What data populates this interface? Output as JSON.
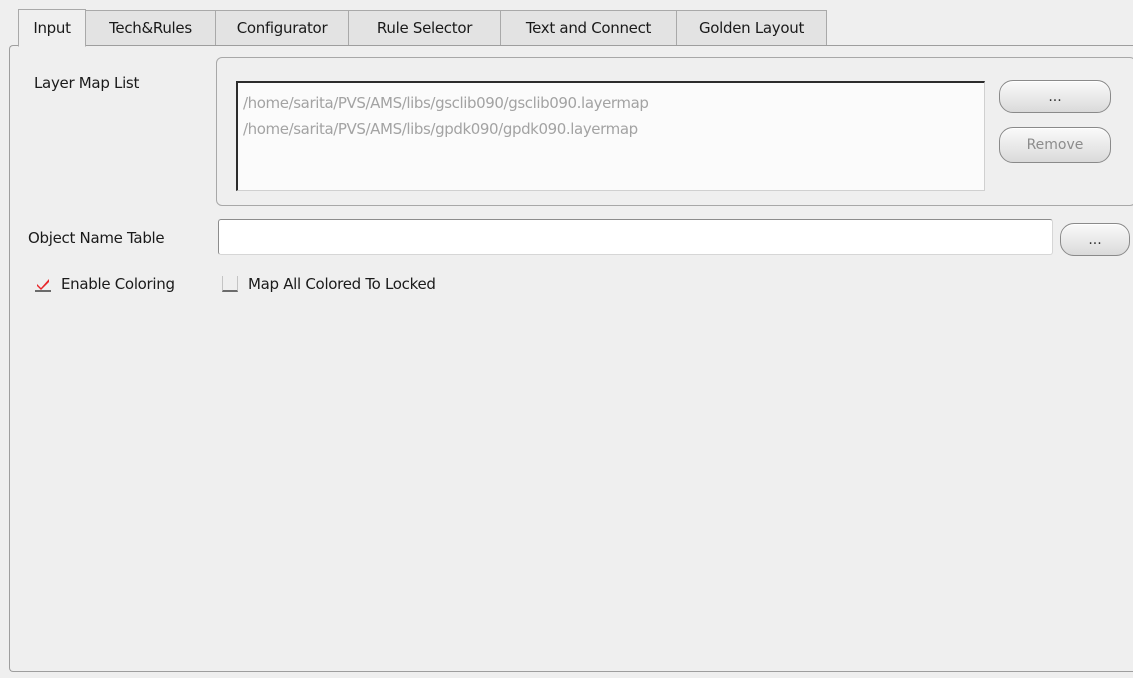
{
  "tabs": [
    {
      "label": "Input",
      "active": true
    },
    {
      "label": "Tech&Rules",
      "active": false
    },
    {
      "label": "Configurator",
      "active": false
    },
    {
      "label": "Rule Selector",
      "active": false
    },
    {
      "label": "Text and Connect",
      "active": false
    },
    {
      "label": "Golden Layout",
      "active": false
    }
  ],
  "layer_map": {
    "label": "Layer Map List",
    "items": [
      "/home/sarita/PVS/AMS/libs/gsclib090/gsclib090.layermap",
      "/home/sarita/PVS/AMS/libs/gpdk090/gpdk090.layermap"
    ],
    "browse_label": "...",
    "remove_label": "Remove"
  },
  "object_name_table": {
    "label": "Object Name Table",
    "value": "",
    "browse_label": "..."
  },
  "options": {
    "enable_coloring": {
      "label": "Enable Coloring",
      "checked": true
    },
    "map_all_colored": {
      "label": "Map All Colored To Locked",
      "checked": false
    }
  },
  "colors": {
    "checkmark": "#e8262a",
    "disabled_text": "#a3a3a3",
    "panel_bg": "#efefef"
  },
  "icons": {
    "checkbox_checked": "checkmark-icon"
  }
}
